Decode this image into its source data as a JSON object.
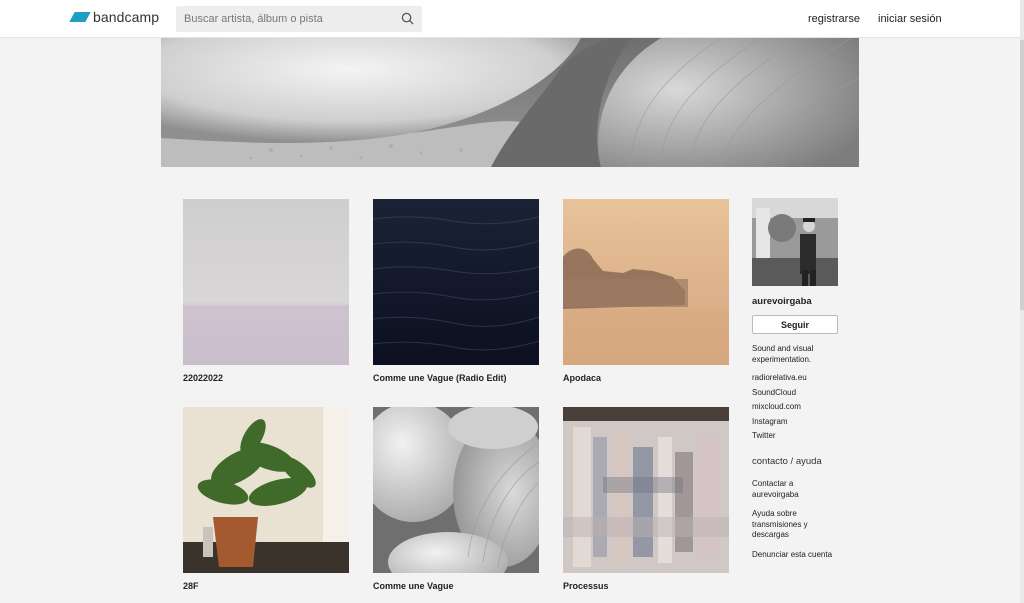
{
  "header": {
    "logo_text": "bandcamp",
    "search_placeholder": "Buscar artista, álbum o pista",
    "signup_label": "registrarse",
    "login_label": "iniciar sesión"
  },
  "albums": [
    {
      "title": "22022022"
    },
    {
      "title": "Comme une Vague (Radio Edit)"
    },
    {
      "title": "Apodaca"
    },
    {
      "title": "28F"
    },
    {
      "title": "Comme une Vague"
    },
    {
      "title": "Processus"
    }
  ],
  "sidebar": {
    "artist_name": "aurevoirgaba",
    "follow_label": "Seguir",
    "bio": "Sound and visual experimentation.",
    "links": [
      "radiorelativa.eu",
      "SoundCloud",
      "mixcloud.com",
      "Instagram",
      "Twitter"
    ],
    "contact_heading": "contacto / ayuda",
    "contact_links": [
      "Contactar a aurevoirgaba",
      "Ayuda sobre transmisiones y descargas",
      "Denunciar esta cuenta"
    ]
  },
  "colors": {
    "brand": "#1da0c3",
    "page_bg": "#f3f3f3"
  }
}
